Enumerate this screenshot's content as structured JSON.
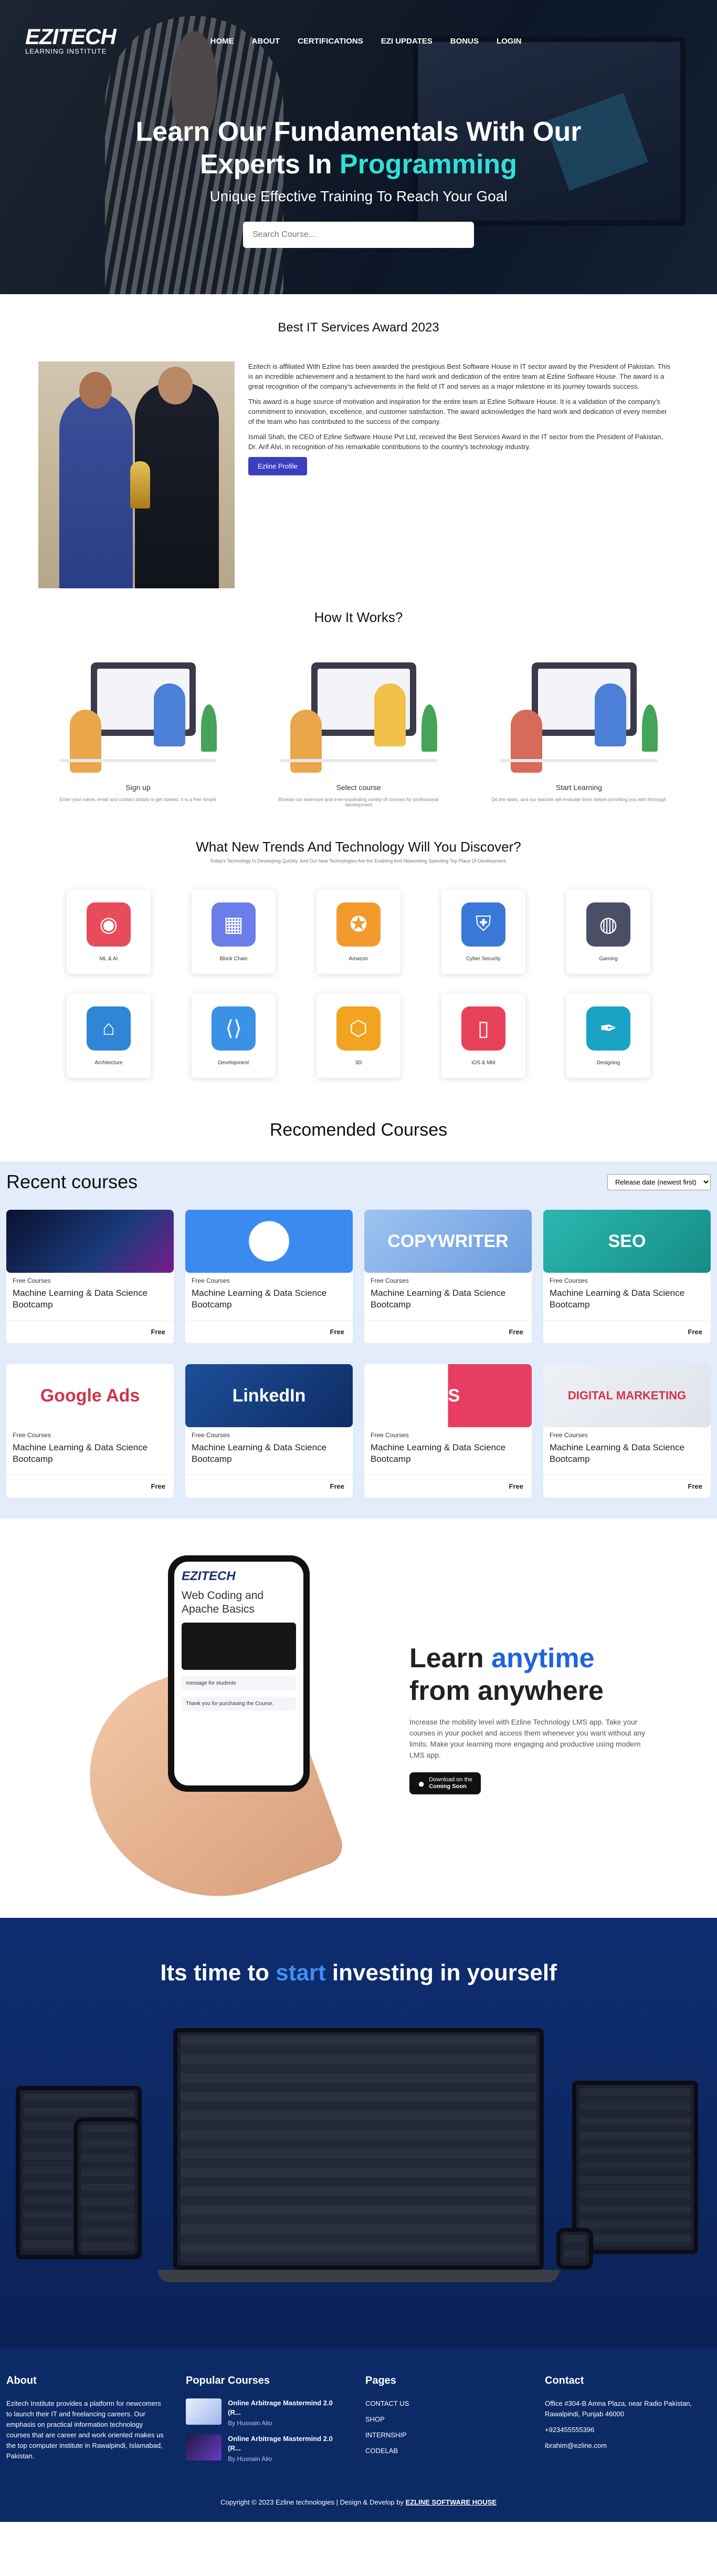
{
  "nav": {
    "logo_main": "EZITECH",
    "logo_sub": "LEARNING INSTITUTE",
    "items": [
      "HOME",
      "ABOUT",
      "CERTIFICATIONS",
      "EZI UPDATES",
      "BONUS",
      "LOGIN"
    ]
  },
  "hero": {
    "line1": "Learn Our Fundamentals With Our",
    "line2_pre": "Experts In ",
    "line2_accent": "Programming",
    "subtitle": "Unique Effective Training To Reach Your Goal",
    "search_placeholder": "Search Course..."
  },
  "award": {
    "title": "Best IT Services Award 2023",
    "p1_bold": "Ezitech is affiliated With",
    "p1": "Ezitech is affiliated With                                         Ezline has been awarded the prestigious Best Software House in IT sector award by the President of Pakistan. This is an incredible achievement and a testament to the hard work and dedication of the entire team at Ezline Software House. The award is a great recognition of the company's achievements in the field of IT and serves as a major milestone in its journey towards success.",
    "p2": "This award is a huge source of motivation and inspiration for the entire team at Ezline Software House. It is a validation of the company's commitment to innovation, excellence, and customer satisfaction. The award acknowledges the hard work and dedication of every member of the team who has contributed to the success of the company.",
    "p3": "Ismail Shah, the CEO of Ezline Software House Pvt Ltd, received the Best Services Award in the IT sector from the President of Pakistan, Dr. Arif Alvi, in recognition of his remarkable contributions to the country's technology industry.",
    "button": "Ezline Profile"
  },
  "how": {
    "title": "How It Works?",
    "steps": [
      {
        "title": "Sign up",
        "desc": "Enter your name, email and contact details to get started. It is a free simple"
      },
      {
        "title": "Select course",
        "desc": "Browse our extensive and ever-expanding variety of courses for professional development"
      },
      {
        "title": "Start Learning",
        "desc": "Do the tasks, and our teacher will evaluate them before providing you with thorough"
      }
    ]
  },
  "trends": {
    "title": "What New Trends And Technology Will You Discover?",
    "subtitle": "Today's Technology Is Developing Quickly. And Our New Technologies Are the Enabling And Networking Spending Top Place Of Development.",
    "items": [
      {
        "label": "ML & AI",
        "icon": "brain-icon",
        "color": "#e84b5b",
        "glyph": "◉"
      },
      {
        "label": "Block Chain",
        "icon": "blockchain-icon",
        "color": "#6a7de8",
        "glyph": "▦"
      },
      {
        "label": "Amazon",
        "icon": "amazon-icon",
        "color": "#f29a2e",
        "glyph": "✪"
      },
      {
        "label": "Cyber Security",
        "icon": "shield-icon",
        "color": "#3a78d8",
        "glyph": "⛨"
      },
      {
        "label": "Gaming",
        "icon": "gamepad-icon",
        "color": "#4a4f66",
        "glyph": "◍"
      },
      {
        "label": "Architecture",
        "icon": "blueprint-icon",
        "color": "#2f86d6",
        "glyph": "⌂"
      },
      {
        "label": "Development",
        "icon": "code-icon",
        "color": "#3b91e6",
        "glyph": "⟨⟩"
      },
      {
        "label": "3D",
        "icon": "cube-3d-icon",
        "color": "#f2a31f",
        "glyph": "⬡"
      },
      {
        "label": "iOS & Mbl",
        "icon": "mobile-icon",
        "color": "#e8425a",
        "glyph": "▯"
      },
      {
        "label": "Designing",
        "icon": "pen-tool-icon",
        "color": "#1ba3c6",
        "glyph": "✒"
      }
    ]
  },
  "recommended_title": "Recomended Courses",
  "recent": {
    "title": "Recent courses",
    "sort_selected": "Release date (newest first)",
    "row1": [
      {
        "free": "Free Courses",
        "title": "Machine Learning & Data Science Bootcamp",
        "price": "Free",
        "img_text": "",
        "bg": "linear-gradient(135deg,#0a1030,#1b3b7a 60%,#7a1a8f)"
      },
      {
        "free": "Free Courses",
        "title": "Machine Learning & Data Science Bootcamp",
        "price": "Free",
        "img_text": "",
        "bg": "radial-gradient(circle,#ffffff 0 22%,#3b8af0 23%)"
      },
      {
        "free": "Free Courses",
        "title": "Machine Learning & Data Science Bootcamp",
        "price": "Free",
        "img_text": "COPYWRITER",
        "bg": "linear-gradient(135deg,#9fc3f0,#6a9be0)"
      },
      {
        "free": "Free Courses",
        "title": "Machine Learning & Data Science Bootcamp",
        "price": "Free",
        "img_text": "SEO",
        "bg": "linear-gradient(135deg,#2ab8b0,#168c86)"
      }
    ],
    "row2": [
      {
        "free": "Free Courses",
        "title": "Machine Learning & Data Science Bootcamp",
        "price": "Free",
        "img_text": "Google Ads",
        "bg": "#ffffff"
      },
      {
        "free": "Free Courses",
        "title": "Machine Learning & Data Science Bootcamp",
        "price": "Free",
        "img_text": "LinkedIn",
        "bg": "linear-gradient(135deg,#1d4f9a,#0e2c63)"
      },
      {
        "free": "Free Courses",
        "title": "Machine Learning & Data Science Bootcamp",
        "price": "Free",
        "img_text": "VS",
        "bg": "linear-gradient(90deg,#ffffff 50%,#e83d62 50%)"
      },
      {
        "free": "Free Courses",
        "title": "Machine Learning & Data Science Bootcamp",
        "price": "Free",
        "img_text": "DIGITAL MARKETING",
        "bg": "linear-gradient(135deg,#eef1f5,#dfe4ec)"
      }
    ]
  },
  "learn": {
    "h_pre": "Learn ",
    "h_accent": "anytime",
    "h_post": " from anywhere",
    "desc": "Increase the mobility level with Ezline Technology LMS app. Take your courses in your pocket and access them whenever you want without any limits. Make your learning more engaging and productive using modern LMS app.",
    "store_line1": "Download on the",
    "store_line2": "Coming Soon",
    "phone": {
      "brand": "EZITECH",
      "title": "Web Coding and Apache Basics",
      "msg1": "message for students",
      "msg2": "Thank you for purchasing the Course."
    }
  },
  "invest": {
    "pre": "Its time to ",
    "accent": "start",
    "post": " investing in yourself"
  },
  "footer": {
    "about_title": "About",
    "about_text": "Ezitech Institute provides a platform for newcomers to launch their IT and freelancing careers. Our emphasis on practical information technology courses that are career and work oriented makes us the top computer institute in Rawalpindi, Islamabad, Pakistan.",
    "popular_title": "Popular Courses",
    "popular": [
      {
        "title": "Online Arbitrage Mastermind 2.0 (R...",
        "by": "By Husnain Alio"
      },
      {
        "title": "Online Arbitrage Mastermind 2.0 (R...",
        "by": "By Husnain Alio"
      }
    ],
    "pages_title": "Pages",
    "pages": [
      "CONTACT US",
      "SHOP",
      "INTERNSHIP",
      "CODELAB"
    ],
    "contact_title": "Contact",
    "address": "Office #304-B Amna Plaza, near Radio Pakistan, Rawalpindi, Punjab 46000",
    "phone": "+923455555396",
    "email": "ibrahim@ezline.com",
    "copyright_pre": "Copyright © 2023 Ezline technologies | Design & Develop by ",
    "copyright_brand": "EZLINE SOFTWARE HOUSE"
  }
}
